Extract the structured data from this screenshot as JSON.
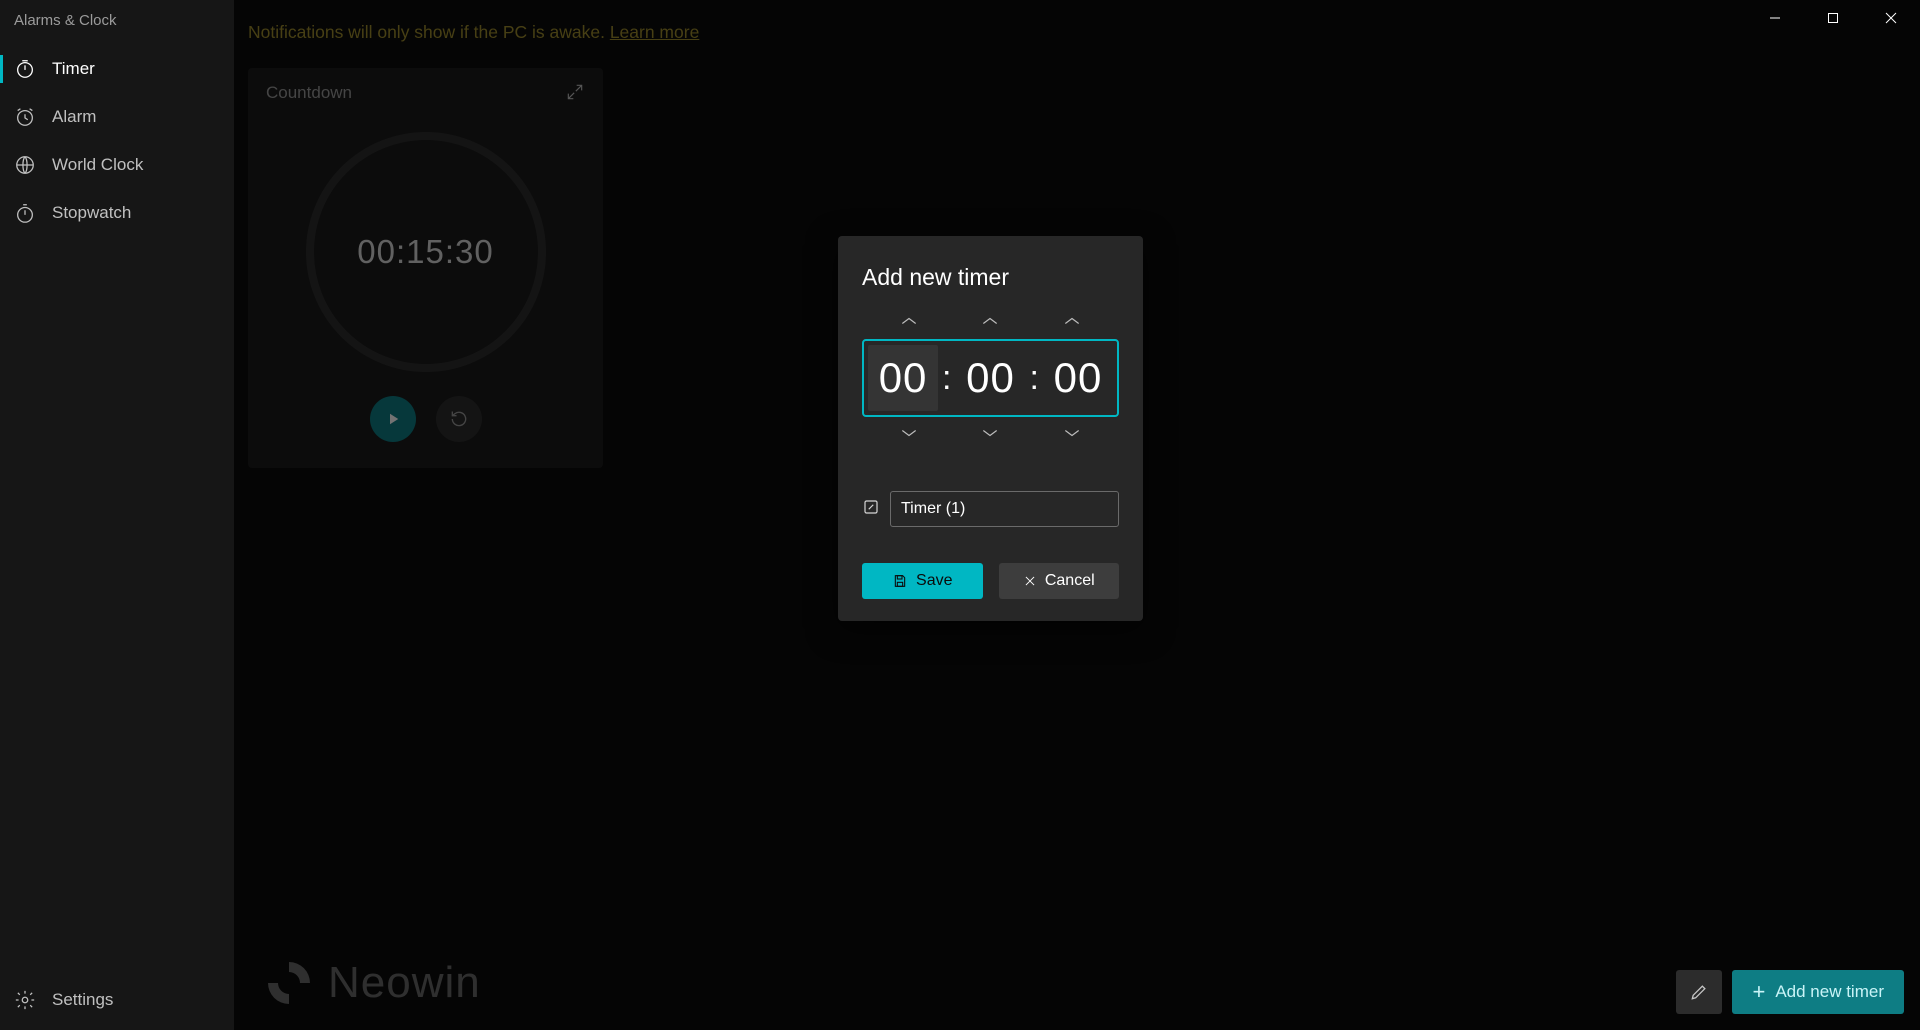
{
  "app_title": "Alarms & Clock",
  "sidebar": {
    "items": [
      {
        "label": "Timer",
        "icon": "timer-icon",
        "active": true
      },
      {
        "label": "Alarm",
        "icon": "alarm-icon",
        "active": false
      },
      {
        "label": "World Clock",
        "icon": "world-clock-icon",
        "active": false
      },
      {
        "label": "Stopwatch",
        "icon": "stopwatch-icon",
        "active": false
      }
    ],
    "settings_label": "Settings"
  },
  "notification": {
    "text": "Notifications will only show if the PC is awake. ",
    "link_text": "Learn more"
  },
  "timer_card": {
    "title": "Countdown",
    "time": "00:15:30"
  },
  "dialog": {
    "title": "Add new timer",
    "hours": "00",
    "minutes": "00",
    "seconds": "00",
    "name_value": "Timer (1)",
    "save_label": "Save",
    "cancel_label": "Cancel"
  },
  "bottom_bar": {
    "add_label": "Add new timer"
  },
  "watermark": "Neowin"
}
